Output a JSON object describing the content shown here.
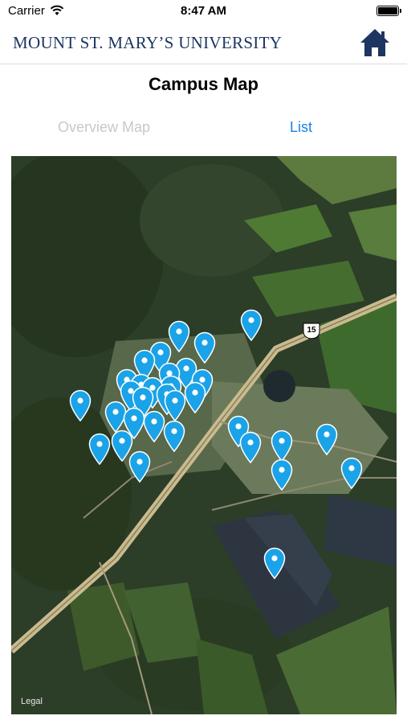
{
  "status_bar": {
    "carrier": "Carrier",
    "time": "8:47 AM"
  },
  "header": {
    "logo": "MOUNT ST. MARY’S UNIVERSITY",
    "home_icon": "home-icon"
  },
  "page": {
    "title": "Campus Map"
  },
  "tabs": [
    {
      "label": "Overview Map",
      "selected": false
    },
    {
      "label": "List",
      "selected": true
    }
  ],
  "map": {
    "legal": "Legal",
    "route_number": "15",
    "pin_icon": "map-pin-icon",
    "pin_color": "#1aa3e8",
    "pin_count": 32
  },
  "colors": {
    "brand": "#1d3561",
    "accent": "#1a7fe8",
    "pin": "#1aa3e8"
  }
}
